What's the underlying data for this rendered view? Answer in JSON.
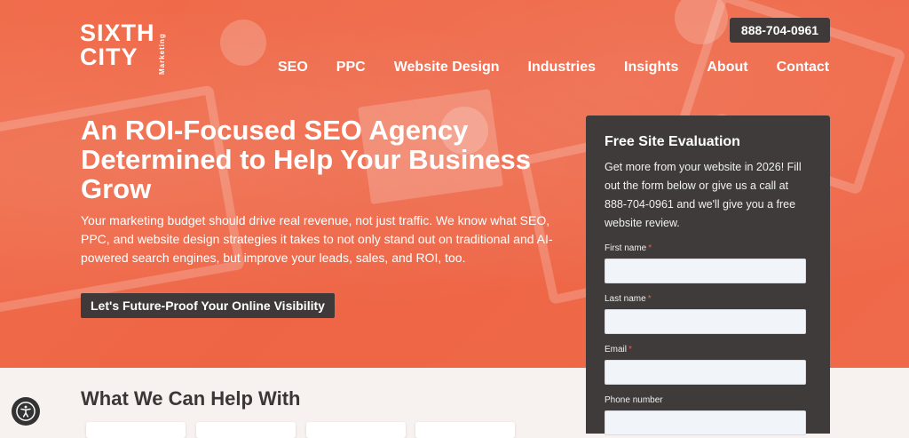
{
  "logo": {
    "line1": "SIXTH",
    "line2": "CITY",
    "side": "Marketing"
  },
  "header": {
    "phone": "888-704-0961"
  },
  "nav": {
    "items": [
      {
        "label": "SEO"
      },
      {
        "label": "PPC"
      },
      {
        "label": "Website Design"
      },
      {
        "label": "Industries"
      },
      {
        "label": "Insights"
      },
      {
        "label": "About"
      },
      {
        "label": "Contact"
      }
    ]
  },
  "hero": {
    "headline": "An ROI-Focused SEO Agency Determined to Help Your Business Grow",
    "subtext": "Your marketing budget should drive real revenue, not just traffic. We know what SEO, PPC, and website design strategies it takes to not only stand out on traditional and AI-powered search engines, but improve your leads, sales, and ROI, too.",
    "cta": "Let's Future-Proof Your Online Visibility"
  },
  "form": {
    "title": "Free Site Evaluation",
    "description": "Get more from your website in 2026! Fill out the form below or give us a call at 888-704-0961 and we'll give you a free website review.",
    "fields": [
      {
        "label": "First name",
        "required": "*",
        "value": ""
      },
      {
        "label": "Last name",
        "required": "*",
        "value": ""
      },
      {
        "label": "Email",
        "required": "*",
        "value": ""
      },
      {
        "label": "Phone number",
        "required": "",
        "value": ""
      }
    ]
  },
  "section": {
    "title": "What We Can Help With"
  },
  "icons": {
    "accessibility": "accessibility-icon"
  },
  "colors": {
    "hero": "#ee6545",
    "dark": "#3e3b3a",
    "required": "#ef5a44"
  }
}
